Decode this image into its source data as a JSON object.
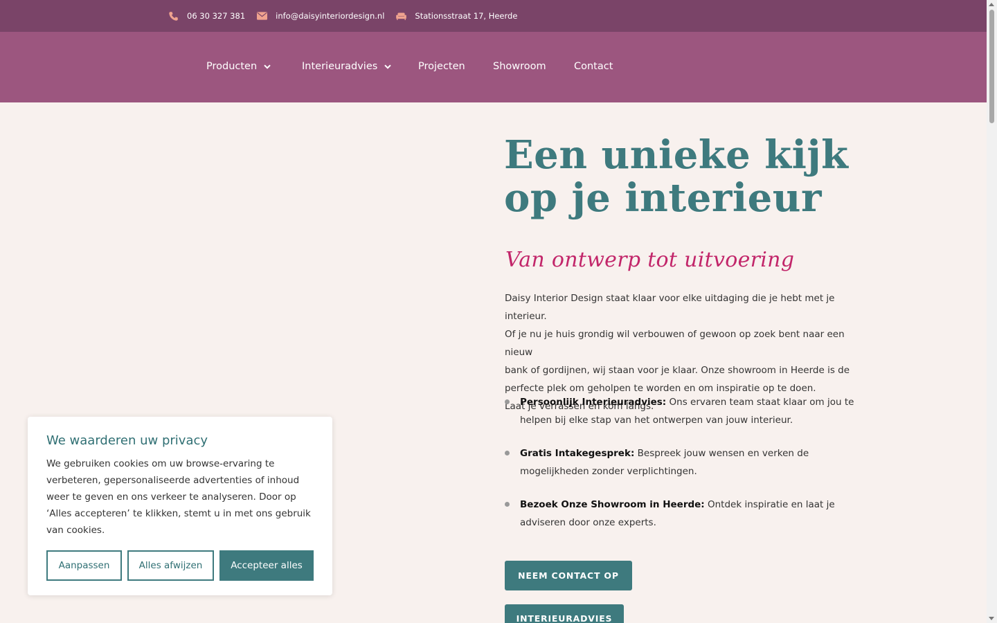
{
  "topbar": {
    "phone": "06 30 327 381",
    "email": "info@daisyinteriordesign.nl",
    "address": "Stationsstraat 17, Heerde",
    "icon_color": "#f0a38f"
  },
  "nav": {
    "items": [
      {
        "label": "Producten",
        "has_dropdown": true
      },
      {
        "label": "Interieuradvies",
        "has_dropdown": true
      },
      {
        "label": "Projecten",
        "has_dropdown": false
      },
      {
        "label": "Showroom",
        "has_dropdown": false
      },
      {
        "label": "Contact",
        "has_dropdown": false
      }
    ]
  },
  "hero": {
    "title_line1": "Een unieke kijk",
    "title_line2": "op je interieur",
    "subtitle": "Van ontwerp tot uitvoering",
    "intro_lines": [
      "Daisy Interior Design staat klaar voor elke uitdaging die je hebt met je interieur.",
      "Of je nu je huis grondig wil verbouwen of gewoon op zoek bent naar een nieuw",
      "bank of gordijnen, wij staan voor je klaar. Onze showroom in Heerde is de",
      "perfecte plek om geholpen te worden en om inspiratie op te doen.",
      "Laat je verrassen en kom langs."
    ],
    "benefits": [
      {
        "bold": "Persoonlijk Interieuradvies:",
        "text": " Ons ervaren team staat klaar om jou te helpen bij elke stap van het ontwerpen van jouw interieur."
      },
      {
        "bold": "Gratis Intakegesprek:",
        "text": " Bespreek jouw wensen en verken de mogelijkheden zonder verplichtingen."
      },
      {
        "bold": "Bezoek Onze Showroom in Heerde:",
        "text": " Ontdek inspiratie en laat je adviseren door onze experts."
      }
    ],
    "cta_contact": "NEEM CONTACT OP",
    "cta_advice": "INTERIEURADVIES"
  },
  "cookie": {
    "title": "We waarderen uw privacy",
    "text": "We gebruiken cookies om uw browse-ervaring te verbeteren, gepersonaliseerde advertenties of inhoud weer te geven en ons verkeer te analyseren. Door op ‘Alles accepteren’ te klikken, stemt u in met ons gebruik van cookies.",
    "customize": "Aanpassen",
    "reject": "Alles afwijzen",
    "accept": "Accepteer alles"
  },
  "colors": {
    "topbar": "#7a4468",
    "navbar": "#9c567f",
    "teal": "#3e7a7e",
    "accent_pink": "#c2266a",
    "background": "#f8f1ee"
  }
}
